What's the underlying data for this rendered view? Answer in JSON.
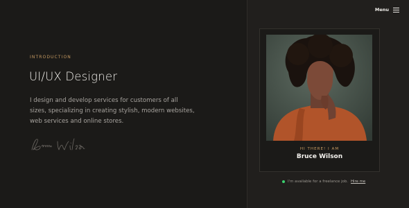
{
  "header": {
    "menu_label": "Menu",
    "menu_icon": "hamburger-icon"
  },
  "intro": {
    "eyebrow": "INTRODUCTION",
    "title": "UI/UX Designer",
    "description": "I design and develop services for customers of all sizes, specializing in creating stylish, modern websites, web services and online stores.",
    "signature": "Bruce Wilson"
  },
  "profile_card": {
    "greeting": "HI THERE! I AM",
    "name": "Bruce Wilson"
  },
  "availability": {
    "text": "I'm available for a freelance job.",
    "link_label": "Hire me",
    "status_color": "#3bd16f"
  },
  "colors": {
    "background": "#1b1a18",
    "accent": "#c79b62",
    "text": "#f1efeb"
  }
}
